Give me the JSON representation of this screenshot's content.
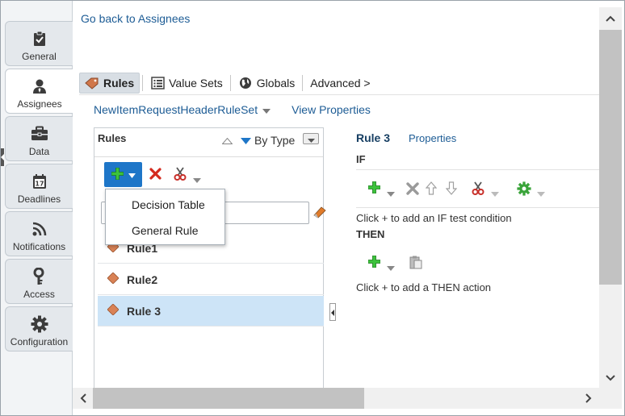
{
  "sidebar": {
    "items": [
      {
        "label": "General",
        "icon": "clipboard-check-icon"
      },
      {
        "label": "Assignees",
        "icon": "user-icon",
        "active": true
      },
      {
        "label": "Data",
        "icon": "briefcase-icon"
      },
      {
        "label": "Deadlines",
        "icon": "calendar-icon"
      },
      {
        "label": "Notifications",
        "icon": "rss-icon"
      },
      {
        "label": "Access",
        "icon": "key-icon"
      },
      {
        "label": "Configuration",
        "icon": "gear-icon"
      }
    ]
  },
  "header": {
    "back_link": "Go back to Assignees"
  },
  "toolbar": {
    "rules": "Rules",
    "value_sets": "Value Sets",
    "globals": "Globals",
    "advanced": "Advanced >"
  },
  "ruleset": {
    "name": "NewItemRequestHeaderRuleSet",
    "view_properties": "View Properties"
  },
  "rules_panel": {
    "title": "Rules",
    "sort_label": "By Type",
    "search_value": "",
    "items": [
      {
        "label": "Rule1"
      },
      {
        "label": "Rule2"
      },
      {
        "label": "Rule 3",
        "selected": true
      }
    ]
  },
  "add_menu": {
    "items": [
      "Decision Table",
      "General Rule"
    ]
  },
  "detail": {
    "title": "Rule 3",
    "properties_link": "Properties",
    "if_label": "IF",
    "if_hint": "Click + to add an IF test condition",
    "then_label": "THEN",
    "then_hint": "Click + to add a THEN action"
  },
  "colors": {
    "accent": "#1e76c8",
    "link": "#1d5c95",
    "selected_row": "#cde4f7",
    "add_green": "#2fa82f",
    "delete_red": "#d42a1e"
  }
}
